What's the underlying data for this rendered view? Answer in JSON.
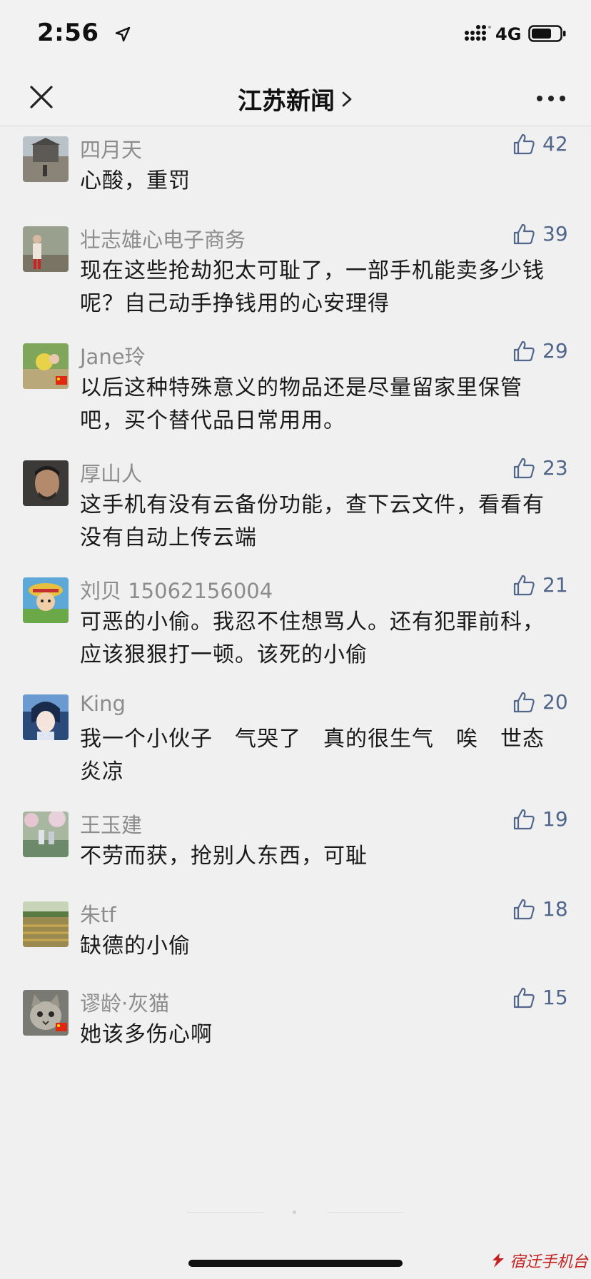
{
  "status_bar": {
    "time": "2:56",
    "network": "4G",
    "icons": [
      "location-arrow-icon",
      "signal-icon",
      "battery-icon"
    ]
  },
  "nav": {
    "title": "江苏新闻",
    "close_icon": "close-icon",
    "chevron_icon": "chevron-right-icon",
    "more_icon": "more-dots-icon"
  },
  "comments": [
    {
      "name": "四月天",
      "text": "心酸，重罚",
      "likes": "42"
    },
    {
      "name": "壮志雄心电子商务",
      "text": "现在这些抢劫犯太可耻了，一部手机能卖多少钱呢？自己动手挣钱用的心安理得",
      "likes": "39"
    },
    {
      "name": "Jane玲",
      "text": "以后这种特殊意义的物品还是尽量留家里保管吧，买个替代品日常用用。",
      "likes": "29"
    },
    {
      "name": "厚山人",
      "text": "这手机有没有云备份功能，查下云文件，看看有没有自动上传云端",
      "likes": "23"
    },
    {
      "name": "刘贝 15062156004",
      "text": "可恶的小偷。我忍不住想骂人。还有犯罪前科，应该狠狠打一顿。该死的小偷",
      "likes": "21"
    },
    {
      "name": "King",
      "text": "我一个小伙子　气哭了　真的很生气　唉　世态炎凉",
      "likes": "20"
    },
    {
      "name": "王玉建",
      "text": "不劳而获，抢别人东西，可耻",
      "likes": "19"
    },
    {
      "name": "朱tf",
      "text": "缺德的小偷",
      "likes": "18"
    },
    {
      "name": "谬龄·灰猫",
      "text": "她该多伤心啊",
      "likes": "15"
    }
  ],
  "watermark": "宿迁手机台",
  "colors": {
    "background": "#f0f0f0",
    "name_gray": "#8c8c8c",
    "like_blue": "#50668a",
    "watermark_red": "#c42020"
  }
}
